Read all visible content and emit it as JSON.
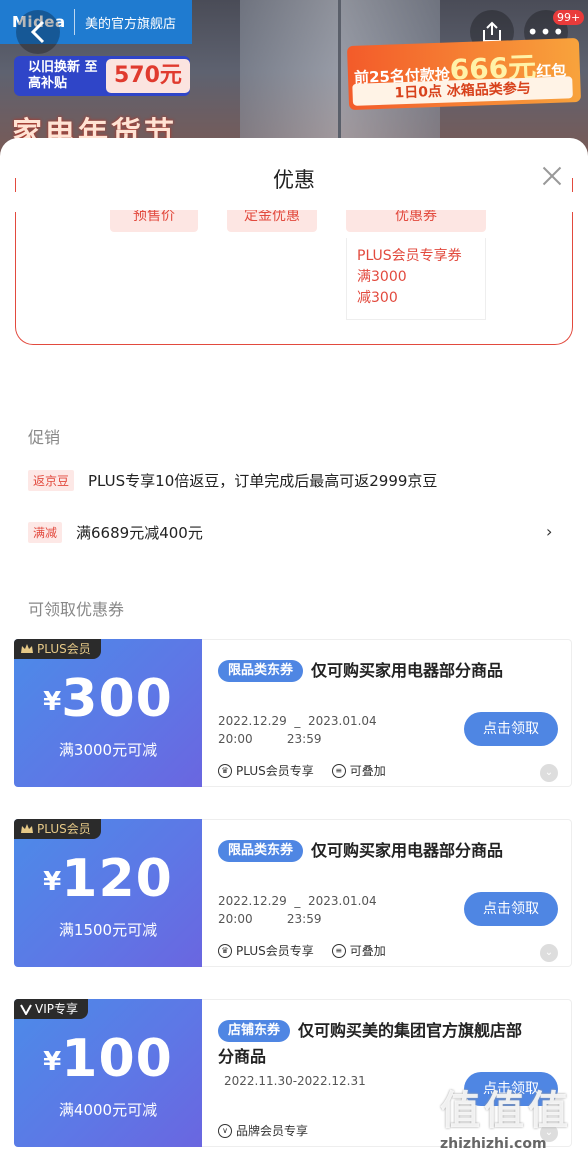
{
  "banner": {
    "brand_logo": "Midea",
    "store_name": "美的官方旗舰店",
    "back_icon": "chevron-left-icon",
    "share_icon": "share-icon",
    "more_label": "•••",
    "badge_count": "99+",
    "trade_in_text": "以旧换新 至高补贴",
    "trade_in_amount": "570元",
    "festival_text": "家电年货节",
    "promo_line1_prefix": "前25名付款抢",
    "promo_line1_amount": "666元",
    "promo_line1_suffix": "红包",
    "promo_line2": "1日0点 冰箱品类参与"
  },
  "sheet": {
    "title": "优惠",
    "close_icon": "close-icon"
  },
  "discount_box": {
    "chips": [
      "预售价",
      "定金优惠",
      "优惠券"
    ],
    "plus_coupon_lines": [
      "PLUS会员专享券",
      "满3000",
      "减300"
    ]
  },
  "promotions": {
    "title": "促销",
    "items": [
      {
        "tag": "返京豆",
        "text": "PLUS专享10倍返豆，订单完成后最高可返2999京豆"
      },
      {
        "tag": "满减",
        "text": "满6689元减400元"
      }
    ],
    "chevron": "›"
  },
  "coupons": {
    "title": "可领取优惠券",
    "items": [
      {
        "badge": "PLUS会员",
        "badge_icon": "crown-icon",
        "currency": "¥",
        "amount": "300",
        "condition": "满3000元可减",
        "type": "限品类东券",
        "desc": "仅可购买家用电器部分商品",
        "date": "2022.12.29  _  2023.01.04\n20:00         23:59",
        "button": "点击领取",
        "foot": [
          {
            "icon": "crown-icon",
            "text": "PLUS会员专享"
          },
          {
            "icon": "stack-icon",
            "text": "可叠加"
          }
        ]
      },
      {
        "badge": "PLUS会员",
        "badge_icon": "crown-icon",
        "currency": "¥",
        "amount": "120",
        "condition": "满1500元可减",
        "type": "限品类东券",
        "desc": "仅可购买家用电器部分商品",
        "date": "2022.12.29  _  2023.01.04\n20:00         23:59",
        "button": "点击领取",
        "foot": [
          {
            "icon": "crown-icon",
            "text": "PLUS会员专享"
          },
          {
            "icon": "stack-icon",
            "text": "可叠加"
          }
        ]
      },
      {
        "badge": "VIP专享",
        "badge_icon": "v-icon",
        "currency": "¥",
        "amount": "100",
        "condition": "满4000元可减",
        "type": "店铺东券",
        "desc": "仅可购买美的集团官方旗舰店部分商品",
        "date": "2022.11.30-2022.12.31",
        "button": "点击领取",
        "foot": [
          {
            "icon": "v-icon",
            "text": "品牌会员专享"
          }
        ]
      }
    ]
  },
  "watermark": {
    "glyphs": "值",
    "site": "zhizhizhi.com"
  }
}
